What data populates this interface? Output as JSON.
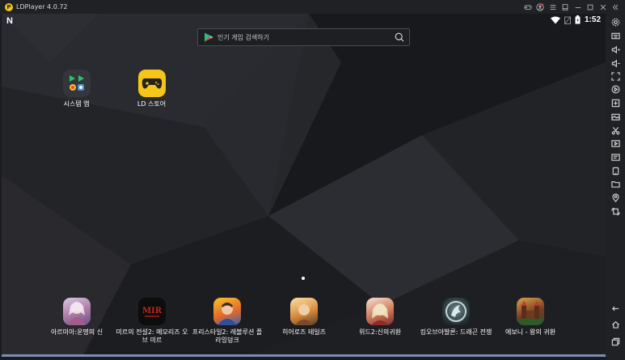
{
  "window": {
    "title": "LDPlayer 4.0.72",
    "logo_letter": "P"
  },
  "titlebar_controls": [
    {
      "name": "gamepad-icon"
    },
    {
      "name": "account-icon"
    },
    {
      "name": "menu-icon"
    },
    {
      "name": "bookmark-icon"
    },
    {
      "name": "minimize-icon"
    },
    {
      "name": "maximize-icon"
    },
    {
      "name": "close-icon"
    },
    {
      "name": "collapse-sidebar-icon"
    }
  ],
  "statusbar": {
    "left_logo": "N",
    "time": "1:52"
  },
  "search": {
    "placeholder": "인기 게임 검색하기"
  },
  "desktop_apps": [
    {
      "label": "시스템 앱",
      "icon": "system-apps-folder-icon"
    },
    {
      "label": "LD 스토어",
      "icon": "ld-store-icon",
      "color": "#f5c518"
    }
  ],
  "dock_apps": [
    {
      "label": "아르미아:운명의 신",
      "icon": "armia-game-icon"
    },
    {
      "label": "미르의 전설2: 메모리즈 오",
      "label2": "브 미르",
      "icon": "mir-legend-icon"
    },
    {
      "label": "프리스타일2: 레볼루션 플",
      "label2": "라잉덩크",
      "icon": "freestyle2-icon"
    },
    {
      "label": "히어로즈 테일즈",
      "icon": "heroes-tales-icon"
    },
    {
      "label": "위드2:신의귀환",
      "icon": "wid2-icon"
    },
    {
      "label": "킹오브아발론: 드래곤 전쟁",
      "icon": "king-of-avalon-icon"
    },
    {
      "label": "에보니 - 왕의 귀환",
      "icon": "ebony-icon"
    }
  ],
  "colors": {
    "titlebar_bg": "#202124",
    "screen_bg": "#202125",
    "accent_yellow": "#f5c518",
    "progress_line": "#7d8fb0"
  },
  "sidebar_items": [
    {
      "name": "settings-icon"
    },
    {
      "name": "keyboard-icon"
    },
    {
      "name": "volume-up-icon"
    },
    {
      "name": "volume-down-icon"
    },
    {
      "name": "fullscreen-icon"
    },
    {
      "name": "record-icon"
    },
    {
      "name": "add-apk-icon"
    },
    {
      "name": "screenshot-icon"
    },
    {
      "name": "scissors-icon"
    },
    {
      "name": "video-icon"
    },
    {
      "name": "operation-record-icon"
    },
    {
      "name": "multi-instance-icon"
    },
    {
      "name": "folder-icon"
    },
    {
      "name": "location-icon"
    },
    {
      "name": "rotate-icon"
    },
    {
      "name": "back-icon"
    },
    {
      "name": "home-icon"
    },
    {
      "name": "recent-apps-icon"
    }
  ]
}
